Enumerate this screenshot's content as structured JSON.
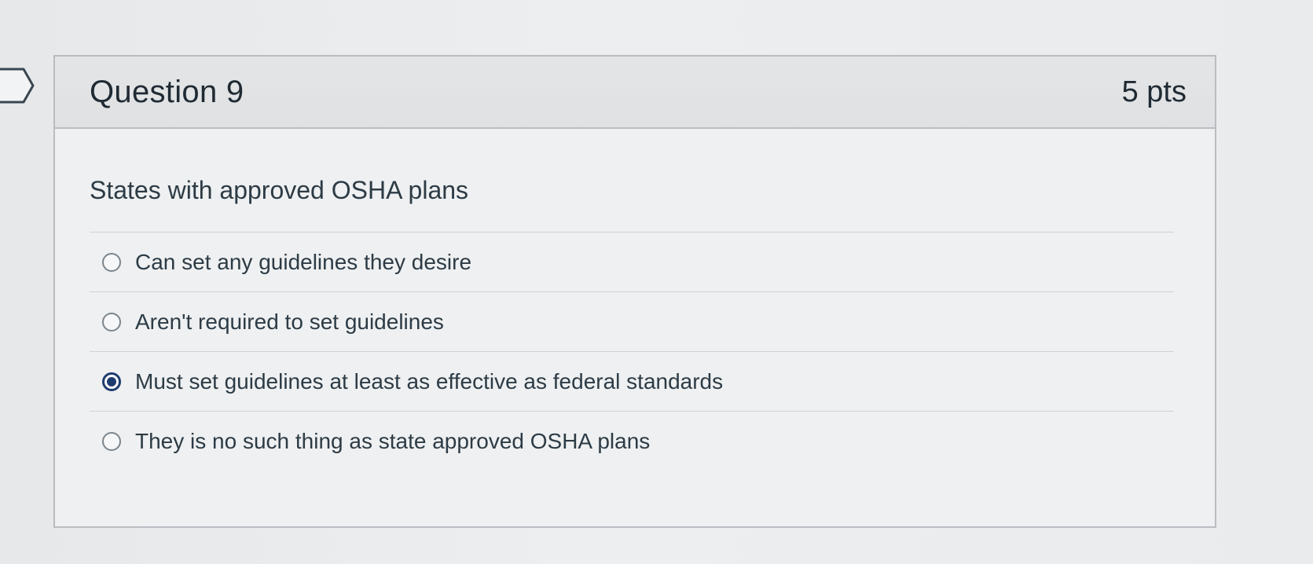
{
  "question": {
    "title": "Question 9",
    "points": "5 pts",
    "text": "States with approved OSHA plans",
    "answers": [
      {
        "label": "Can set any guidelines they desire",
        "selected": false
      },
      {
        "label": "Aren't required to set guidelines",
        "selected": false
      },
      {
        "label": "Must set guidelines at least as effective as federal standards",
        "selected": true
      },
      {
        "label": "They is no such thing as state approved OSHA plans",
        "selected": false
      }
    ]
  },
  "colors": {
    "accent": "#1f3c6e",
    "border": "#b9bdc1",
    "header_bg": "#e1e3e5",
    "text": "#2d3b45"
  },
  "icons": {
    "bookmark": "bookmark-flag-icon"
  }
}
